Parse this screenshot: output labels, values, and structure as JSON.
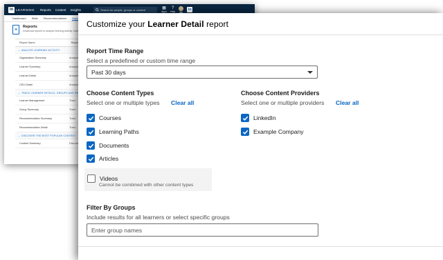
{
  "background_app": {
    "logo_glyph": "in",
    "logo_text": "LEARNING",
    "nav": [
      "Reports",
      "Content",
      "Insights"
    ],
    "search_placeholder": "Search for people, groups or content",
    "top_icons": [
      {
        "icon": "grid-icon",
        "label": "Apps"
      },
      {
        "icon": "help-icon",
        "label": "Help"
      },
      {
        "icon": "avatar",
        "label": "Me"
      }
    ],
    "brand_badge": "in",
    "tabs": [
      "Dashboard",
      "Skills",
      "Recommendations",
      "Reports"
    ],
    "active_tab": "Reports",
    "page_title": "Reports",
    "page_subtitle": "Download reports to analyze learning activity, track...",
    "table_headers": [
      "Report Name",
      "Report"
    ],
    "sections": [
      {
        "title": "ANALYZE LEARNING ACTIVITY",
        "rows": [
          {
            "name": "Organization Summary",
            "desc": "Analyze"
          },
          {
            "name": "Learner Summary",
            "desc": "Analyze"
          },
          {
            "name": "Learner Detail",
            "desc": "Analyze"
          },
          {
            "name": "CEU Detail",
            "desc": "Analyze"
          }
        ]
      },
      {
        "title": "TRACK LEARNER DETAILS, GROUPS AND RECOMMENDATIONS",
        "rows": [
          {
            "name": "Learner Management",
            "desc": "Track"
          },
          {
            "name": "Group Summary",
            "desc": "Track"
          },
          {
            "name": "Recommendation Summary",
            "desc": "Track"
          },
          {
            "name": "Recommendation Detail",
            "desc": "Track"
          }
        ]
      },
      {
        "title": "DISCOVER THE MOST POPULAR CONTENT",
        "rows": [
          {
            "name": "Content Summary",
            "desc": "Discover"
          }
        ]
      }
    ]
  },
  "modal": {
    "title_prefix": "Customize your ",
    "title_bold": "Learner Detail",
    "title_suffix": " report",
    "time_range": {
      "label": "Report Time Range",
      "sublabel": "Select a predefined or custom time range",
      "selected": "Past 30 days"
    },
    "content_types": {
      "label": "Choose Content Types",
      "sublabel": "Select one or multiple types",
      "clear_label": "Clear all",
      "options": [
        {
          "label": "Courses",
          "checked": true
        },
        {
          "label": "Learning Paths",
          "checked": true
        },
        {
          "label": "Documents",
          "checked": true
        },
        {
          "label": "Articles",
          "checked": true
        }
      ],
      "videos": {
        "label": "Videos",
        "checked": false,
        "note": "Cannot be combined with other content types"
      }
    },
    "content_providers": {
      "label": "Choose Content Providers",
      "sublabel": "Select one or multiple providers",
      "clear_label": "Clear all",
      "options": [
        {
          "label": "LinkedIn",
          "checked": true
        },
        {
          "label": "Example Company",
          "checked": true
        }
      ]
    },
    "groups": {
      "label": "Filter By Groups",
      "sublabel": "Include results for all learners or select specific groups",
      "placeholder": "Enter group names"
    }
  },
  "colors": {
    "accent": "#0a66c2",
    "nav_bar": "#0a2640"
  }
}
